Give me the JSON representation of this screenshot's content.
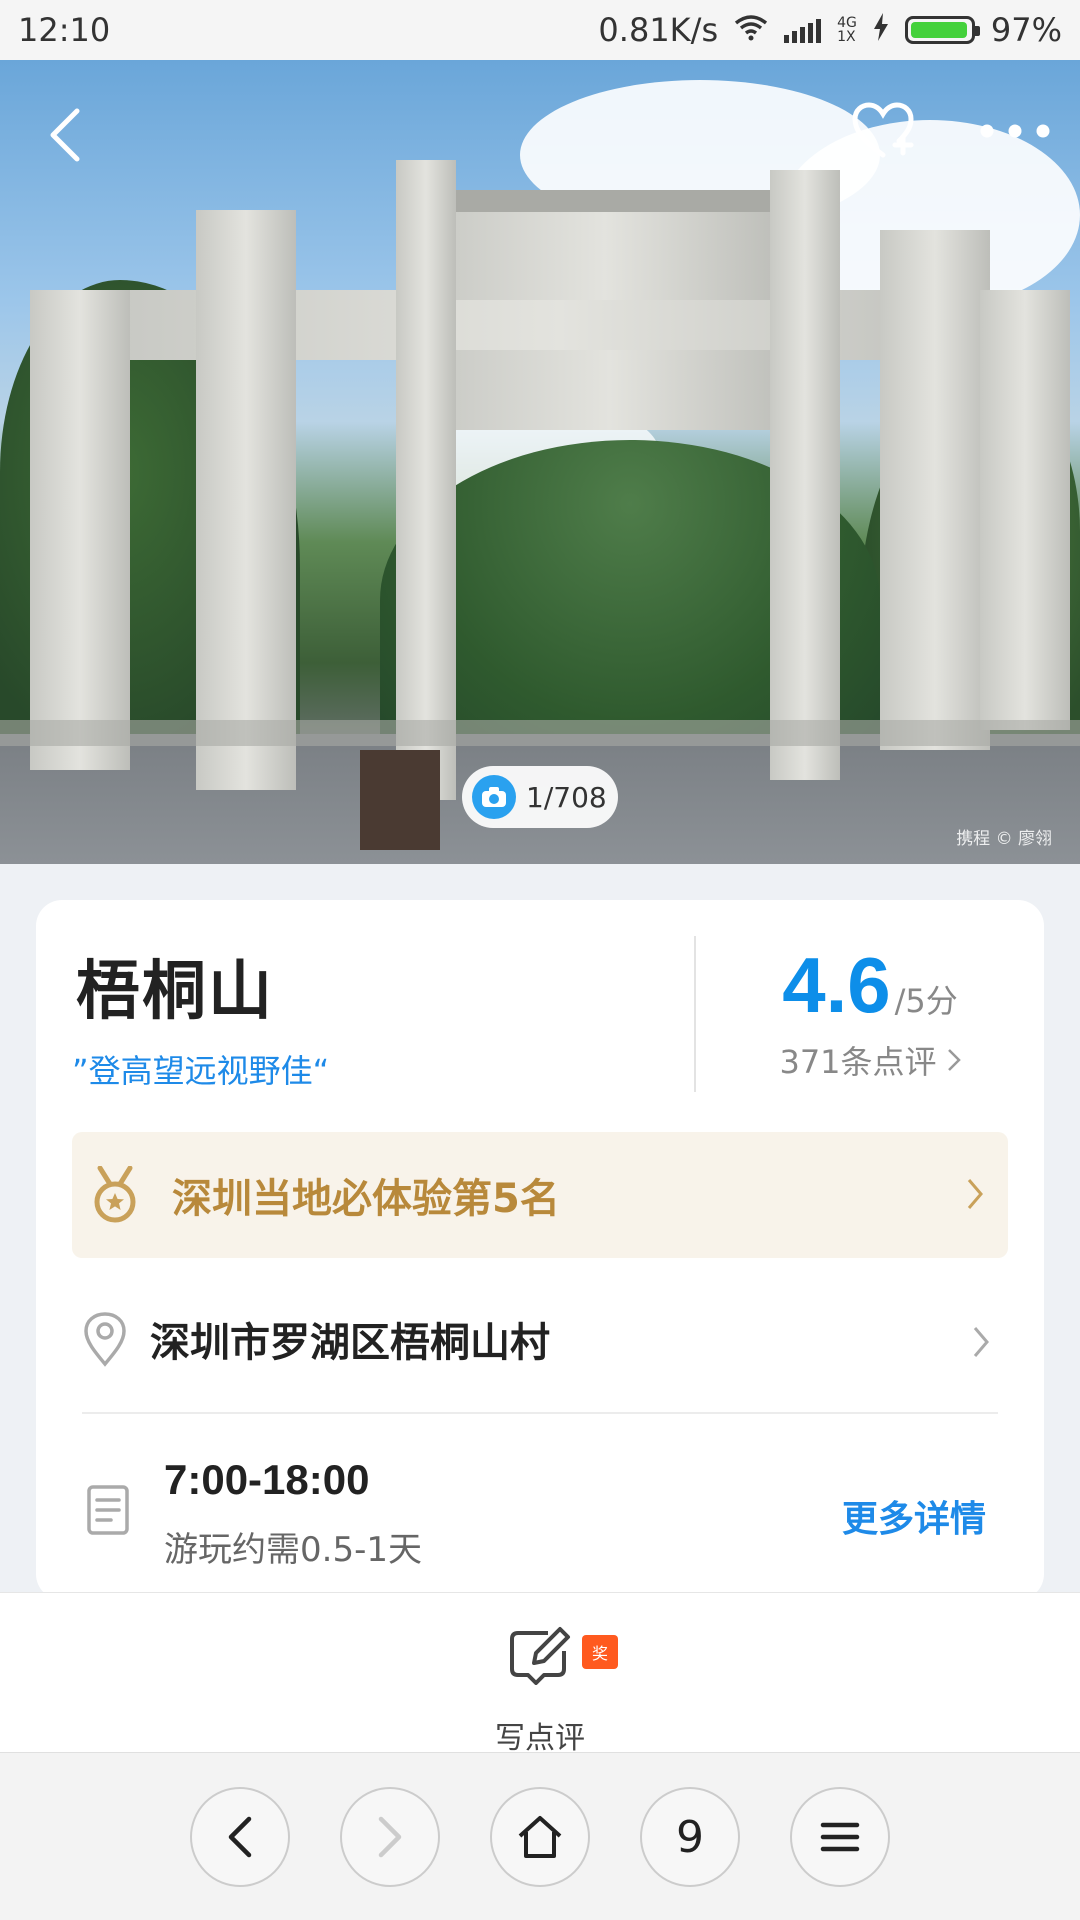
{
  "status_bar": {
    "time": "12:10",
    "net_speed": "0.81K/s",
    "net_type_top": "4G",
    "net_type_bottom": "1X",
    "battery_pct": "97%",
    "battery_level": 0.97
  },
  "hero": {
    "photo_counter": "1/708",
    "watermark": "携程 © 廖翎"
  },
  "poi": {
    "name": "梧桐山",
    "slogan": "”登高望远视野佳“",
    "rating": "4.6",
    "rating_max": "/5分",
    "review_count": "371条点评",
    "rank": "深圳当地必体验第5名",
    "address": "深圳市罗湖区梧桐山村",
    "hours": "7:00-18:00",
    "duration": "游玩约需0.5-1天",
    "more_details": "更多详情"
  },
  "action_bar": {
    "write_review": "写点评",
    "badge": "奖"
  },
  "nav_bar": {
    "tab_count": "9"
  },
  "colors": {
    "accent_blue": "#0d8ee9",
    "rank_gold": "#b8893b",
    "badge_orange": "#ff5a1f"
  }
}
